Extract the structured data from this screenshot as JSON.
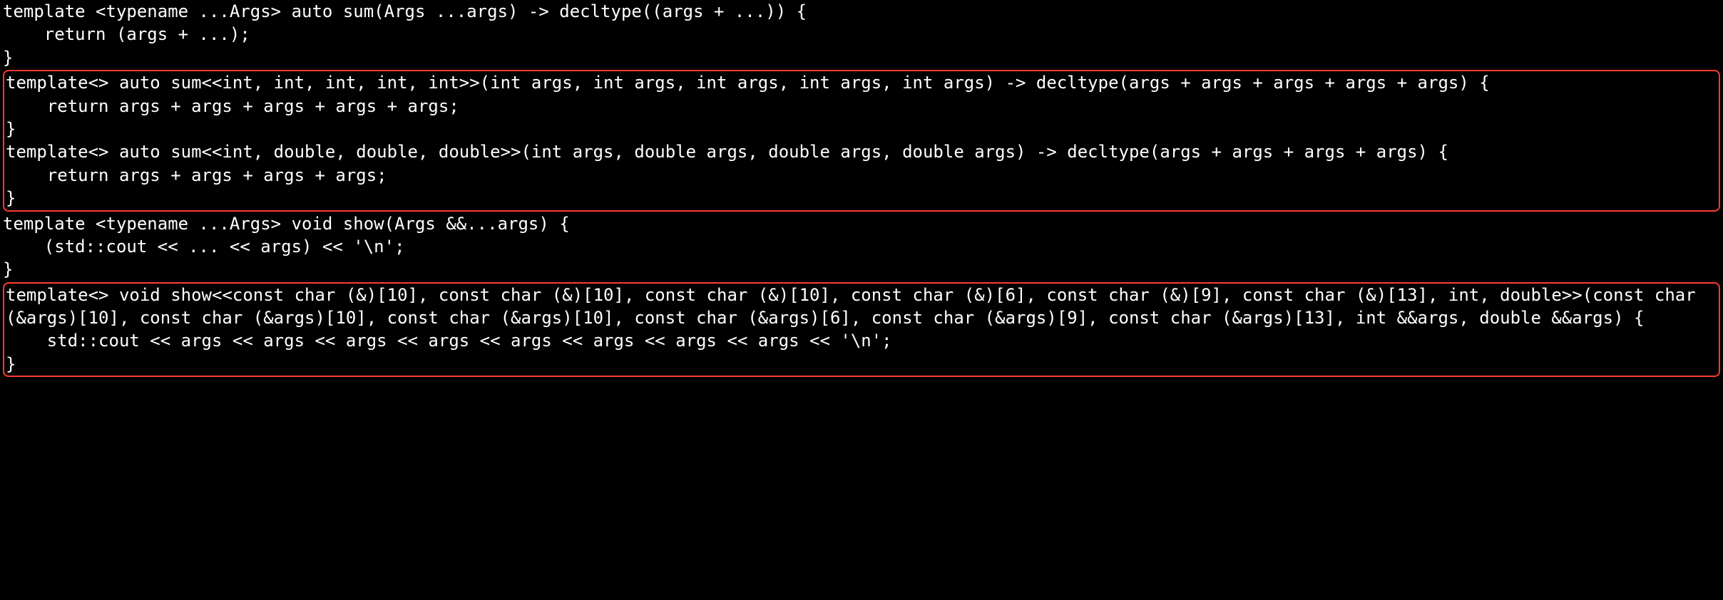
{
  "code": {
    "block1": "template <typename ...Args> auto sum(Args ...args) -> decltype((args + ...)) {\n    return (args + ...);\n}",
    "highlight1": "template<> auto sum<<int, int, int, int, int>>(int args, int args, int args, int args, int args) -> decltype(args + args + args + args + args) {\n    return args + args + args + args + args;\n}\ntemplate<> auto sum<<int, double, double, double>>(int args, double args, double args, double args) -> decltype(args + args + args + args) {\n    return args + args + args + args;\n}",
    "block2": "template <typename ...Args> void show(Args &&...args) {\n    (std::cout << ... << args) << '\\n';\n}",
    "highlight2": "template<> void show<<const char (&)[10], const char (&)[10], const char (&)[10], const char (&)[6], const char (&)[9], const char (&)[13], int, double>>(const char (&args)[10], const char (&args)[10], const char (&args)[10], const char (&args)[6], const char (&args)[9], const char (&args)[13], int &&args, double &&args) {\n    std::cout << args << args << args << args << args << args << args << args << '\\n';\n}"
  }
}
